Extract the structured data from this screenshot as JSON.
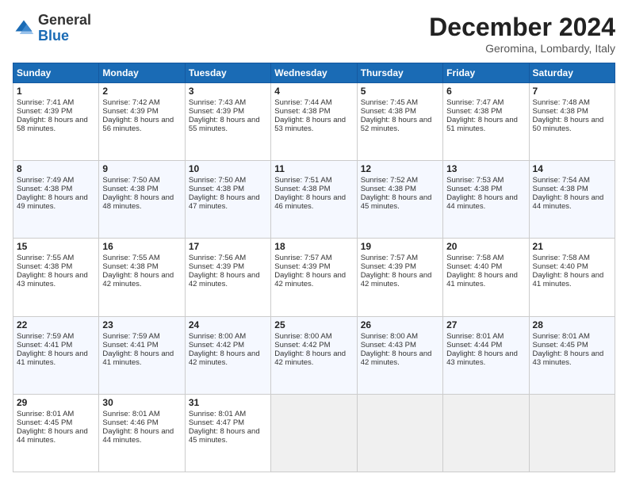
{
  "logo": {
    "general": "General",
    "blue": "Blue"
  },
  "header": {
    "month_year": "December 2024",
    "location": "Geromina, Lombardy, Italy"
  },
  "days": [
    "Sunday",
    "Monday",
    "Tuesday",
    "Wednesday",
    "Thursday",
    "Friday",
    "Saturday"
  ],
  "weeks": [
    [
      {
        "day": "1",
        "sunrise": "7:41 AM",
        "sunset": "4:39 PM",
        "daylight": "8 hours and 58 minutes."
      },
      {
        "day": "2",
        "sunrise": "7:42 AM",
        "sunset": "4:39 PM",
        "daylight": "8 hours and 56 minutes."
      },
      {
        "day": "3",
        "sunrise": "7:43 AM",
        "sunset": "4:39 PM",
        "daylight": "8 hours and 55 minutes."
      },
      {
        "day": "4",
        "sunrise": "7:44 AM",
        "sunset": "4:38 PM",
        "daylight": "8 hours and 53 minutes."
      },
      {
        "day": "5",
        "sunrise": "7:45 AM",
        "sunset": "4:38 PM",
        "daylight": "8 hours and 52 minutes."
      },
      {
        "day": "6",
        "sunrise": "7:47 AM",
        "sunset": "4:38 PM",
        "daylight": "8 hours and 51 minutes."
      },
      {
        "day": "7",
        "sunrise": "7:48 AM",
        "sunset": "4:38 PM",
        "daylight": "8 hours and 50 minutes."
      }
    ],
    [
      {
        "day": "8",
        "sunrise": "7:49 AM",
        "sunset": "4:38 PM",
        "daylight": "8 hours and 49 minutes."
      },
      {
        "day": "9",
        "sunrise": "7:50 AM",
        "sunset": "4:38 PM",
        "daylight": "8 hours and 48 minutes."
      },
      {
        "day": "10",
        "sunrise": "7:50 AM",
        "sunset": "4:38 PM",
        "daylight": "8 hours and 47 minutes."
      },
      {
        "day": "11",
        "sunrise": "7:51 AM",
        "sunset": "4:38 PM",
        "daylight": "8 hours and 46 minutes."
      },
      {
        "day": "12",
        "sunrise": "7:52 AM",
        "sunset": "4:38 PM",
        "daylight": "8 hours and 45 minutes."
      },
      {
        "day": "13",
        "sunrise": "7:53 AM",
        "sunset": "4:38 PM",
        "daylight": "8 hours and 44 minutes."
      },
      {
        "day": "14",
        "sunrise": "7:54 AM",
        "sunset": "4:38 PM",
        "daylight": "8 hours and 44 minutes."
      }
    ],
    [
      {
        "day": "15",
        "sunrise": "7:55 AM",
        "sunset": "4:38 PM",
        "daylight": "8 hours and 43 minutes."
      },
      {
        "day": "16",
        "sunrise": "7:55 AM",
        "sunset": "4:38 PM",
        "daylight": "8 hours and 42 minutes."
      },
      {
        "day": "17",
        "sunrise": "7:56 AM",
        "sunset": "4:39 PM",
        "daylight": "8 hours and 42 minutes."
      },
      {
        "day": "18",
        "sunrise": "7:57 AM",
        "sunset": "4:39 PM",
        "daylight": "8 hours and 42 minutes."
      },
      {
        "day": "19",
        "sunrise": "7:57 AM",
        "sunset": "4:39 PM",
        "daylight": "8 hours and 42 minutes."
      },
      {
        "day": "20",
        "sunrise": "7:58 AM",
        "sunset": "4:40 PM",
        "daylight": "8 hours and 41 minutes."
      },
      {
        "day": "21",
        "sunrise": "7:58 AM",
        "sunset": "4:40 PM",
        "daylight": "8 hours and 41 minutes."
      }
    ],
    [
      {
        "day": "22",
        "sunrise": "7:59 AM",
        "sunset": "4:41 PM",
        "daylight": "8 hours and 41 minutes."
      },
      {
        "day": "23",
        "sunrise": "7:59 AM",
        "sunset": "4:41 PM",
        "daylight": "8 hours and 41 minutes."
      },
      {
        "day": "24",
        "sunrise": "8:00 AM",
        "sunset": "4:42 PM",
        "daylight": "8 hours and 42 minutes."
      },
      {
        "day": "25",
        "sunrise": "8:00 AM",
        "sunset": "4:42 PM",
        "daylight": "8 hours and 42 minutes."
      },
      {
        "day": "26",
        "sunrise": "8:00 AM",
        "sunset": "4:43 PM",
        "daylight": "8 hours and 42 minutes."
      },
      {
        "day": "27",
        "sunrise": "8:01 AM",
        "sunset": "4:44 PM",
        "daylight": "8 hours and 43 minutes."
      },
      {
        "day": "28",
        "sunrise": "8:01 AM",
        "sunset": "4:45 PM",
        "daylight": "8 hours and 43 minutes."
      }
    ],
    [
      {
        "day": "29",
        "sunrise": "8:01 AM",
        "sunset": "4:45 PM",
        "daylight": "8 hours and 44 minutes."
      },
      {
        "day": "30",
        "sunrise": "8:01 AM",
        "sunset": "4:46 PM",
        "daylight": "8 hours and 44 minutes."
      },
      {
        "day": "31",
        "sunrise": "8:01 AM",
        "sunset": "4:47 PM",
        "daylight": "8 hours and 45 minutes."
      },
      null,
      null,
      null,
      null
    ]
  ],
  "labels": {
    "sunrise": "Sunrise:",
    "sunset": "Sunset:",
    "daylight": "Daylight:"
  }
}
